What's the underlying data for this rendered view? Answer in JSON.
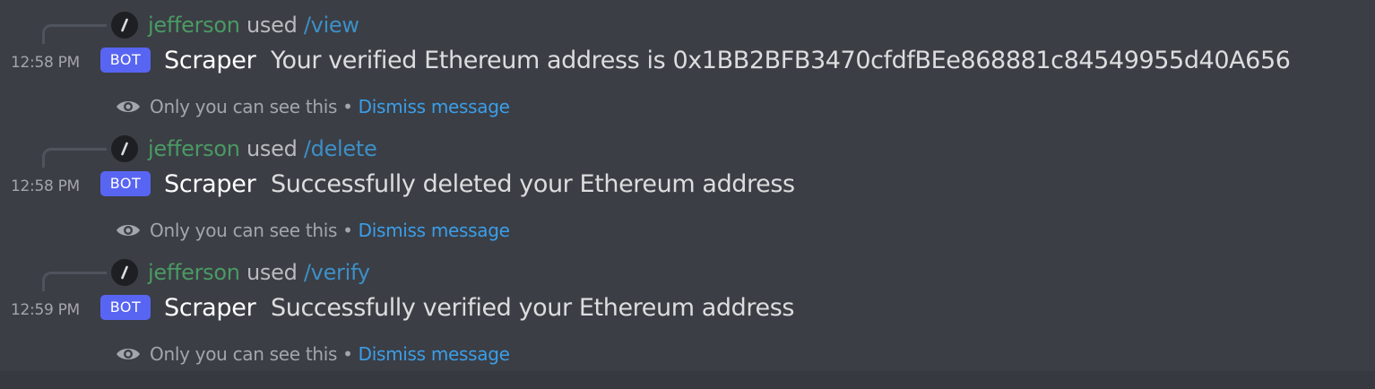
{
  "messages": [
    {
      "command_user": "jefferson",
      "used_text": "used",
      "command": "/view",
      "timestamp": "12:58 PM",
      "bot_tag": "BOT",
      "username": "Scraper",
      "content": "Your verified Ethereum address is 0x1BB2BFB3470cfdfBEe868881c84549955d40A656",
      "ephemeral_note": "Only you can see this",
      "bullet": "•",
      "dismiss_label": "Dismiss message"
    },
    {
      "command_user": "jefferson",
      "used_text": "used",
      "command": "/delete",
      "timestamp": "12:58 PM",
      "bot_tag": "BOT",
      "username": "Scraper",
      "content": "Successfully deleted your Ethereum address",
      "ephemeral_note": "Only you can see this",
      "bullet": "•",
      "dismiss_label": "Dismiss message"
    },
    {
      "command_user": "jefferson",
      "used_text": "used",
      "command": "/verify",
      "timestamp": "12:59 PM",
      "bot_tag": "BOT",
      "username": "Scraper",
      "content": "Successfully verified your Ethereum address",
      "ephemeral_note": "Only you can see this",
      "bullet": "•",
      "dismiss_label": "Dismiss message"
    }
  ],
  "icons": {
    "slash": "slash-command-icon",
    "eye": "eye-icon"
  },
  "colors": {
    "background": "#36393f",
    "message_background": "#3b3e45",
    "command_user": "#4a9a63",
    "command_name": "#3d8fc6",
    "bot_tag": "#5865f2",
    "dismiss_link": "#3b9ee8"
  }
}
